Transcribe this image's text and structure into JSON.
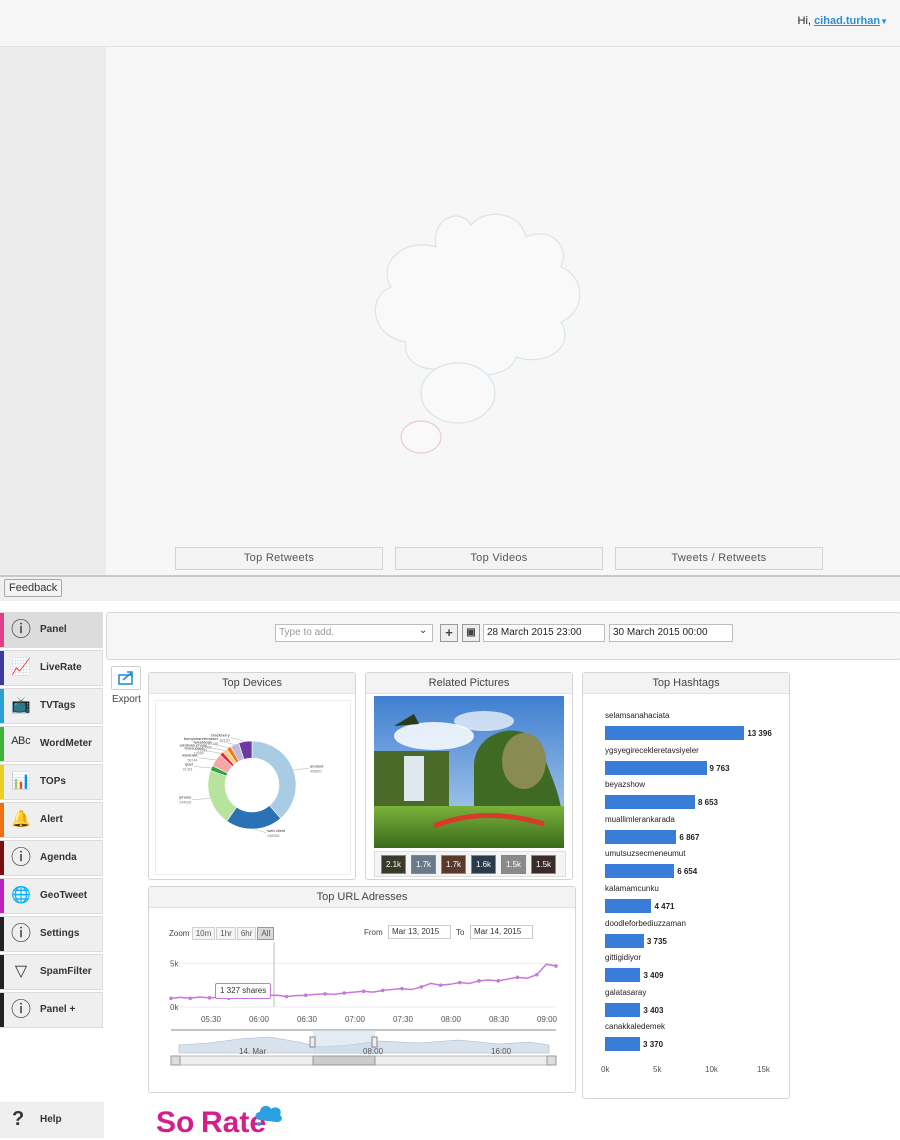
{
  "header": {
    "greeting": "Hi,",
    "username": "cihad.turhan"
  },
  "bottom_tabs": [
    {
      "label": "Top Retweets"
    },
    {
      "label": "Top Videos"
    },
    {
      "label": "Tweets / Retweets"
    }
  ],
  "feedback_label": "Feedback",
  "sidebar": {
    "items": [
      {
        "label": "Panel",
        "icon": "info-circle-icon",
        "color": "#e0408a"
      },
      {
        "label": "LiveRate",
        "icon": "line-chart-icon",
        "color": "#3a3aa0"
      },
      {
        "label": "TVTags",
        "icon": "tv-icon",
        "color": "#2aa0d6"
      },
      {
        "label": "WordMeter",
        "icon": "abc-icon",
        "color": "#3ab53a"
      },
      {
        "label": "TOPs",
        "icon": "bar-trend-icon",
        "color": "#e8d020"
      },
      {
        "label": "Alert",
        "icon": "bell-icon",
        "color": "#f07010"
      },
      {
        "label": "Agenda",
        "icon": "info-circle-icon",
        "color": "#7a1010"
      },
      {
        "label": "GeoTweet",
        "icon": "globe-icon",
        "color": "#c020c0"
      },
      {
        "label": "Settings",
        "icon": "info-circle-icon",
        "color": "#222222"
      },
      {
        "label": "SpamFilter",
        "icon": "filter-icon",
        "color": "#222222"
      },
      {
        "label": "Panel +",
        "icon": "info-circle-icon",
        "color": "#222222"
      }
    ],
    "help_label": "Help"
  },
  "toolbar": {
    "tag_placeholder": "Type to add.",
    "date_from": "28 March 2015 23:00",
    "date_to": "30 March 2015 00:00"
  },
  "export_label": "Export",
  "top_devices": {
    "title": "Top Devices",
    "chart_data": {
      "type": "pie",
      "labels": [
        "android",
        "web client",
        "iphone",
        "ipad",
        "windows",
        "foursquare",
        "windows phone",
        "tweetdeck",
        "bumpsharebrowser",
        "blackberry"
      ],
      "values": [
        456601,
        246956,
        244026,
        21301,
        56744,
        17059,
        21081,
        19900,
        37756,
        57103
      ],
      "colors": [
        "#a9cbe3",
        "#2a72b5",
        "#b7e39f",
        "#31a23a",
        "#f3a8a8",
        "#e02b2b",
        "#ffc98a",
        "#f07d12",
        "#c6b8dd",
        "#6a3aa0"
      ]
    }
  },
  "related_pictures": {
    "title": "Related Pictures",
    "thumbs": [
      {
        "label": "2.1k"
      },
      {
        "label": "1.7k"
      },
      {
        "label": "1.7k"
      },
      {
        "label": "1.6k"
      },
      {
        "label": "1.5k"
      },
      {
        "label": "1.5k"
      }
    ]
  },
  "top_hashtags": {
    "title": "Top Hashtags",
    "chart_data": {
      "type": "bar",
      "orientation": "horizontal",
      "categories": [
        "selamsanahaciata",
        "ygsyegireceklеretavsiyeler",
        "beyazshow",
        "muallimlerankarada",
        "umutsuzsecmeneumut",
        "kalamamcunku",
        "doodleforbediuzzaman",
        "gittigidiyor",
        "galatasaray",
        "canakkaledemek"
      ],
      "values": [
        13396,
        9763,
        8653,
        6867,
        6654,
        4471,
        3735,
        3409,
        3403,
        3370
      ],
      "value_labels": [
        "13 396",
        "9 763",
        "8 653",
        "6 867",
        "6 654",
        "4 471",
        "3 735",
        "3 409",
        "3 403",
        "3 370"
      ],
      "xlim": [
        0,
        15000
      ],
      "x_ticks": [
        "0k",
        "5k",
        "10k",
        "15k"
      ],
      "grid": false
    }
  },
  "top_url": {
    "title": "Top URL Adresses",
    "zoom_label": "Zoom",
    "zoom_options": [
      "10m",
      "1hr",
      "6hr",
      "All"
    ],
    "zoom_selected": "All",
    "from_label": "From",
    "from_value": "Mar 13, 2015",
    "to_label": "To",
    "to_value": "Mar 14, 2015",
    "tooltip": "1 327 shares",
    "navigator_labels": [
      "14. Mar",
      "08:00",
      "16:00"
    ],
    "chart_data": {
      "type": "line",
      "x_ticks": [
        "05:30",
        "06:00",
        "06:30",
        "07:00",
        "07:30",
        "08:00",
        "08:30",
        "09:00"
      ],
      "y_ticks": [
        "0k",
        "5k"
      ],
      "ylim": [
        0,
        5500
      ],
      "series": [
        {
          "color": "#c878d8",
          "x": [
            0,
            1,
            2,
            3,
            4,
            5,
            6,
            7,
            8,
            9,
            10,
            11,
            12,
            13,
            14,
            15,
            16,
            17,
            18,
            19,
            20,
            21,
            22,
            23,
            24,
            25,
            26,
            27,
            28,
            29,
            30,
            31,
            32,
            33,
            34,
            35,
            36,
            37,
            38,
            39,
            40
          ],
          "values": [
            1000,
            1100,
            1000,
            1150,
            1050,
            1100,
            1000,
            1150,
            1300,
            1250,
            1327,
            1350,
            1200,
            1300,
            1350,
            1450,
            1500,
            1450,
            1600,
            1700,
            1800,
            1700,
            1900,
            2000,
            2100,
            2000,
            2300,
            2700,
            2500,
            2600,
            2800,
            2700,
            3000,
            3100,
            3000,
            3200,
            3400,
            3300,
            3700,
            4900,
            4700
          ]
        }
      ]
    }
  },
  "footer": {
    "logo_so": "So",
    "logo_rate": "Rate"
  }
}
